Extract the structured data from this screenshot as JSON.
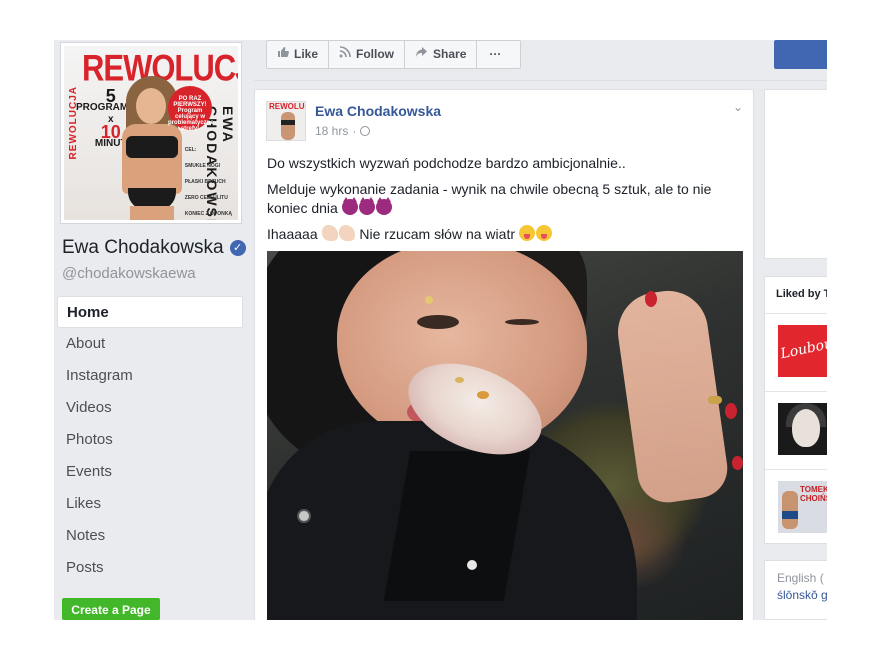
{
  "page": {
    "name": "Ewa Chodakowska",
    "handle": "@chodakowskaewa",
    "verified_icon": "✓"
  },
  "cover": {
    "title": "REWOLUCJA",
    "side_text": "REWOLUCJA",
    "side_text2": "EWA CHODAKOWSKA",
    "badge": "PO RAZ PIERWSZY! Program celujący w problematyczne strefy!",
    "programs_num": "5",
    "programs_label": "PROGRAMÓW",
    "x": "x",
    "minutes_num": "10",
    "minutes_label": "MINUT",
    "list": [
      "CEL:",
      "SMUKŁE NOGI",
      "PŁASKI BRZUCH",
      "ZERO CELLULITU",
      "KONIEC Z OPONKĄ"
    ]
  },
  "nav": {
    "items": [
      "Home",
      "About",
      "Instagram",
      "Videos",
      "Photos",
      "Events",
      "Likes",
      "Notes",
      "Posts"
    ],
    "active_index": 0
  },
  "create_page": "Create a Page",
  "actions": {
    "like": "Like",
    "follow": "Follow",
    "share": "Share",
    "more": "···",
    "like_icon": "thumbs-up-icon",
    "follow_icon": "rss-icon",
    "share_icon": "share-arrow-icon"
  },
  "post": {
    "author": "Ewa Chodakowska",
    "time": "18 hrs",
    "sep": "·",
    "avatar_title": "REWOLUCJA",
    "chevron": "⌄",
    "line1": "Do wszystkich wyzwań podchodze bardzo ambicjonalnie..",
    "line2": "Melduje wykonanie zadania - wynik na chwile obecną 5 sztuk, ale to nie koniec dnia",
    "line3_prefix": "Ihaaaaa",
    "line3_text": "Nie rzucam słów na wiatr"
  },
  "right": {
    "liked_by": "Liked by T",
    "thumb1_text": "Louboutin",
    "thumb3_text": "TOMEK CHOIŃSKI",
    "lang_current": "English (",
    "lang_other": "ślōnskŏ g"
  },
  "colors": {
    "link_blue": "#365899",
    "fb_blue": "#4267b2",
    "green": "#42b72a",
    "bg": "#e9ebee"
  }
}
